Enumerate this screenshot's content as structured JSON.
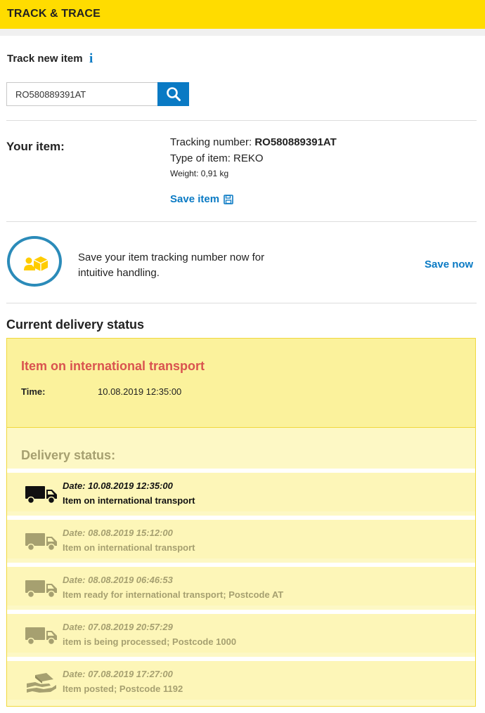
{
  "header": {
    "title": "TRACK & TRACE"
  },
  "track": {
    "label": "Track new item",
    "info_icon": "i",
    "input_value": "RO580889391AT"
  },
  "item": {
    "heading": "Your item:",
    "tracking_label": "Tracking number: ",
    "tracking_number": "RO580889391AT",
    "type_label": "Type of item: ",
    "type_value": "REKO",
    "weight": "Weight: 0,91 kg",
    "save_label": "Save item"
  },
  "promo": {
    "text": "Save your item tracking number now for intuitive handling.",
    "link": "Save now"
  },
  "current": {
    "title": "Current delivery status",
    "headline": "Item on international transport",
    "time_label": "Time:",
    "time_value": "10.08.2019 12:35:00"
  },
  "delivery": {
    "title": "Delivery status:",
    "events": [
      {
        "date": "Date: 10.08.2019 12:35:00",
        "desc": "Item on international transport",
        "icon": "truck-icon",
        "active": true
      },
      {
        "date": "Date: 08.08.2019 15:12:00",
        "desc": "Item on international transport",
        "icon": "truck-icon",
        "active": false
      },
      {
        "date": "Date: 08.08.2019 06:46:53",
        "desc": "Item ready for international transport; Postcode AT",
        "icon": "truck-icon",
        "active": false
      },
      {
        "date": "Date: 07.08.2019 20:57:29",
        "desc": "item is being processed; Postcode 1000",
        "icon": "truck-icon",
        "active": false
      },
      {
        "date": "Date: 07.08.2019 17:27:00",
        "desc": "Item posted; Postcode 1192",
        "icon": "hand-parcel-icon",
        "active": false
      }
    ]
  },
  "colors": {
    "brand_yellow": "#ffdc00",
    "link_blue": "#0a7ac4",
    "status_red": "#d9534f",
    "muted_olive": "#a6a070"
  }
}
